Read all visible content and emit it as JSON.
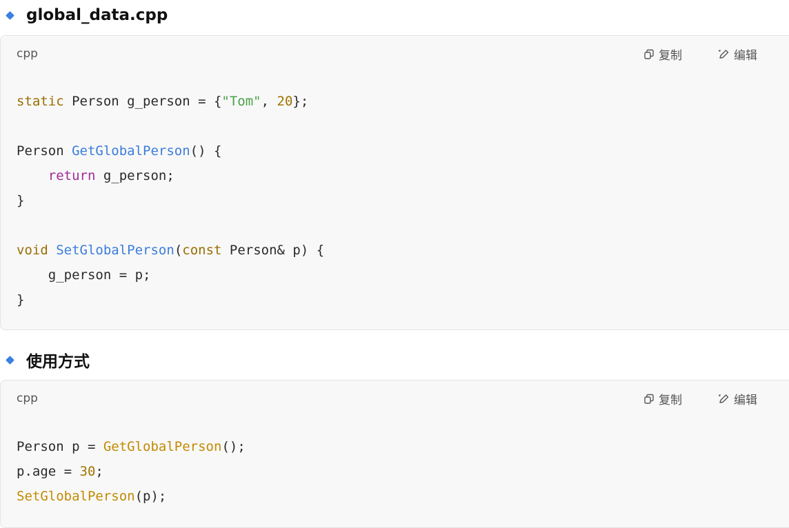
{
  "sections": [
    {
      "heading": "global_data.cpp",
      "lang": "cpp",
      "copy_label": "复制",
      "edit_label": "编辑",
      "code_lines": [
        [
          {
            "t": "static",
            "c": "kw"
          },
          {
            "t": " Person g_person = {",
            "c": ""
          },
          {
            "t": "\"Tom\"",
            "c": "str"
          },
          {
            "t": ", ",
            "c": ""
          },
          {
            "t": "20",
            "c": "num"
          },
          {
            "t": "};",
            "c": ""
          }
        ],
        [],
        [
          {
            "t": "Person ",
            "c": ""
          },
          {
            "t": "GetGlobalPerson",
            "c": "fn"
          },
          {
            "t": "() {",
            "c": ""
          }
        ],
        [
          {
            "t": "    ",
            "c": ""
          },
          {
            "t": "return",
            "c": "kw2"
          },
          {
            "t": " g_person;",
            "c": ""
          }
        ],
        [
          {
            "t": "}",
            "c": ""
          }
        ],
        [],
        [
          {
            "t": "void",
            "c": "kw"
          },
          {
            "t": " ",
            "c": ""
          },
          {
            "t": "SetGlobalPerson",
            "c": "fn"
          },
          {
            "t": "(",
            "c": ""
          },
          {
            "t": "const",
            "c": "kw"
          },
          {
            "t": " Person& p) {",
            "c": ""
          }
        ],
        [
          {
            "t": "    g_person = p;",
            "c": ""
          }
        ],
        [
          {
            "t": "}",
            "c": ""
          }
        ]
      ]
    },
    {
      "heading": "使用方式",
      "lang": "cpp",
      "copy_label": "复制",
      "edit_label": "编辑",
      "code_lines": [
        [
          {
            "t": "Person p = ",
            "c": ""
          },
          {
            "t": "GetGlobalPerson",
            "c": "fn2"
          },
          {
            "t": "();",
            "c": ""
          }
        ],
        [
          {
            "t": "p.age = ",
            "c": ""
          },
          {
            "t": "30",
            "c": "num"
          },
          {
            "t": ";",
            "c": ""
          }
        ],
        [
          {
            "t": "SetGlobalPerson",
            "c": "fn2"
          },
          {
            "t": "(p);",
            "c": ""
          }
        ]
      ]
    }
  ]
}
